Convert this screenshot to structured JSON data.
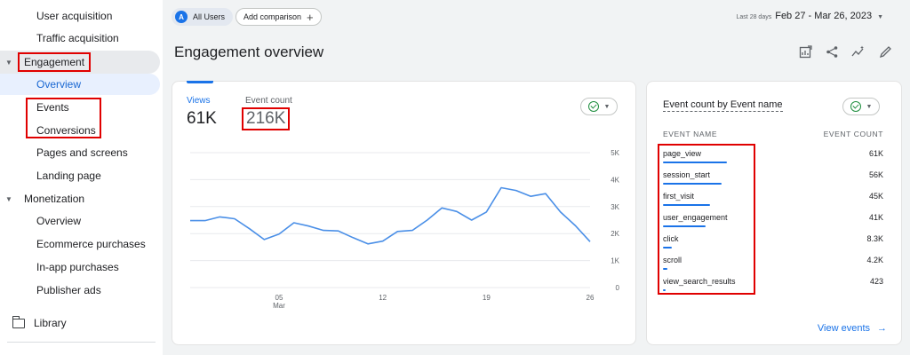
{
  "sidebar": {
    "items_top": [
      "User acquisition",
      "Traffic acquisition"
    ],
    "engagement": {
      "label": "Engagement",
      "items": [
        "Overview",
        "Events",
        "Conversions",
        "Pages and screens",
        "Landing page"
      ]
    },
    "monetization": {
      "label": "Monetization",
      "items": [
        "Overview",
        "Ecommerce purchases",
        "In-app purchases",
        "Publisher ads"
      ]
    },
    "library": "Library"
  },
  "topbar": {
    "user_avatar": "A",
    "user_chip": "All Users",
    "compare_chip": "Add comparison",
    "date_prefix": "Last 28 days",
    "date_range": "Feb 27 - Mar 26, 2023"
  },
  "page_title": "Engagement overview",
  "main_card": {
    "metrics": [
      {
        "label": "Views",
        "value": "61K"
      },
      {
        "label": "Event count",
        "value": "216K"
      }
    ]
  },
  "chart_data": {
    "type": "line",
    "series": [
      {
        "values": [
          2.48,
          2.48,
          2.62,
          2.55,
          2.18,
          1.78,
          1.98,
          2.4,
          2.28,
          2.12,
          2.1,
          1.85,
          1.62,
          1.72,
          2.08,
          2.12,
          2.5,
          2.95,
          2.82,
          2.5,
          2.8,
          3.7,
          3.6,
          3.38,
          3.48,
          2.8,
          2.3,
          1.7
        ]
      }
    ],
    "x_tick_labels": [
      "05",
      "12",
      "19",
      "26"
    ],
    "x_tick_sub": "Mar",
    "x_tick_index": [
      6,
      13,
      20,
      27
    ],
    "y_ticks": [
      0,
      1,
      2,
      3,
      4,
      5
    ],
    "y_tick_labels": [
      "0",
      "1K",
      "2K",
      "3K",
      "4K",
      "5K"
    ],
    "ylim": [
      0,
      5
    ],
    "color": "#4a8fe7",
    "grid": true
  },
  "side_card": {
    "title": "Event count by Event name",
    "col_name": "EVENT NAME",
    "col_count": "EVENT COUNT",
    "rows": [
      {
        "name": "page_view",
        "count": "61K",
        "value": 61000
      },
      {
        "name": "session_start",
        "count": "56K",
        "value": 56000
      },
      {
        "name": "first_visit",
        "count": "45K",
        "value": 45000
      },
      {
        "name": "user_engagement",
        "count": "41K",
        "value": 41000
      },
      {
        "name": "click",
        "count": "8.3K",
        "value": 8300
      },
      {
        "name": "scroll",
        "count": "4.2K",
        "value": 4200
      },
      {
        "name": "view_search_results",
        "count": "423",
        "value": 423
      }
    ],
    "view_link": "View events"
  },
  "colors": {
    "accent": "#1a73e8",
    "highlight": "#e00000",
    "active_bg": "#e8f0fe"
  }
}
